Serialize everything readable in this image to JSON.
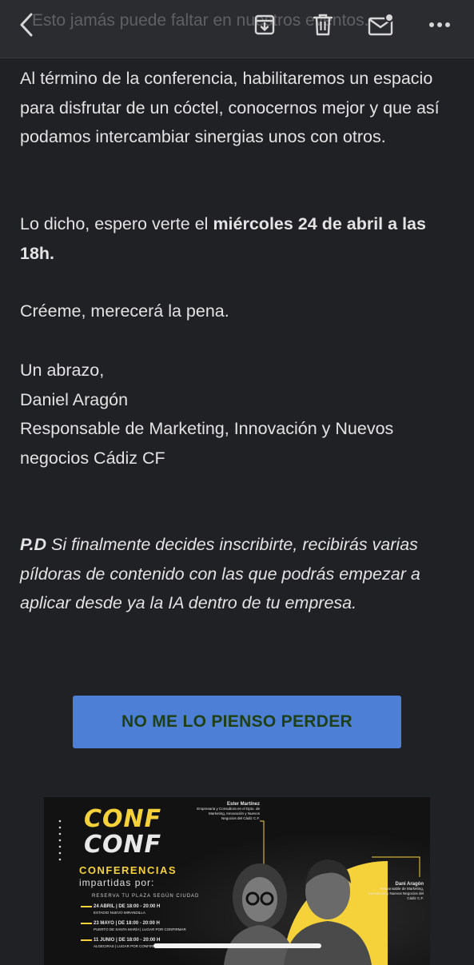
{
  "toolbar": {
    "peek_text": "Esto jamás puede faltar en nuestros eventos.",
    "icons": [
      "back-icon",
      "archive-icon",
      "trash-icon",
      "mark-unread-icon",
      "more-icon"
    ]
  },
  "email": {
    "p1": "Al término de la conferencia, habilitaremos un espacio para disfrutar de un cóctel, conocernos mejor y que así podamos intercambiar sinergias unos con otros.",
    "p2_prefix": "Lo dicho, espero verte el ",
    "p2_bold": "miércoles 24 de abril a las 18h.",
    "p3": "Créeme, merecerá la pena.",
    "signoff": "Un abrazo,",
    "name": "Daniel Aragón",
    "role": "Responsable de Marketing, Innovación y Nuevos negocios Cádiz CF",
    "ps_label": "P.D",
    "ps_text": " Si finalmente decides inscribirte, recibirás varias píldoras de contenido con las que podrás empezar a aplicar desde ya la IA dentro de tu empresa."
  },
  "cta": {
    "label": "NO ME LO PIENSO PERDER"
  },
  "banner": {
    "logo1": "CONF",
    "logo2": "CONF",
    "subtitle": "CONFERENCIAS",
    "subtitle2": "impartidas por:",
    "reserve": "RESERVA TU PLAZA SEGÚN CIUDAD",
    "dates": [
      {
        "date": "24 ABRIL | DE 18:00 - 20:00 H",
        "place": "ESTADIO NUEVO MIRANDILLA"
      },
      {
        "date": "23 MAYO | DE 18:00 - 20:00 H",
        "place": "PUERTO DE SANTA MARÍA | LUGAR POR CONFIRMAR"
      },
      {
        "date": "11 JUNIO | DE 18:00 - 20:00 H",
        "place": "ALGECIRAS | LUGAR POR CONFIRMAR"
      }
    ],
    "speaker1_name": "Ester Martínez",
    "speaker1_role": "Empresaria y Consultora en el Dpto. de Marketing, Innovación y Nuevos Negocios del Cádiz C.F.",
    "speaker2_name": "Dani Aragón",
    "speaker2_role": "Responsable de Marketing, Innovación y Nuevos Negocios del Cádiz C.F.",
    "accent": "#f6d23a"
  },
  "colors": {
    "background": "#202124",
    "toolbar": "#2b2c30",
    "text": "#e3e3e3",
    "button": "#4d7fd6",
    "button_text": "#1f3f17"
  }
}
